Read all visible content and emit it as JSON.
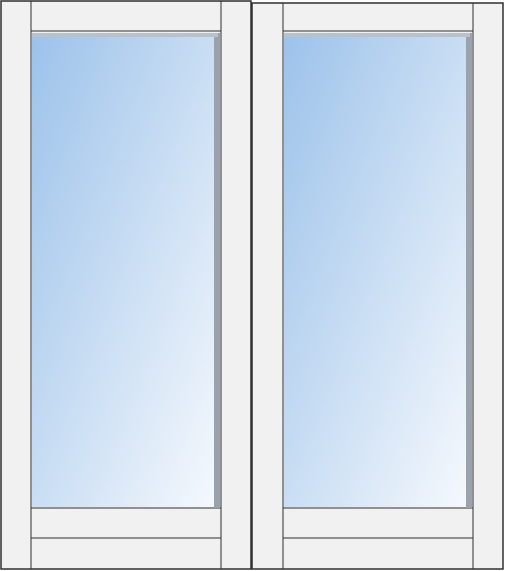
{
  "colors": {
    "frame_fill": "#f1f1f2",
    "frame_stroke": "#2f2f2f",
    "glass_top": "#9cc2ea",
    "glass_bottom": "#f6f9fd",
    "inner_shadow": "#9aa3ad",
    "sash_outline": "#2f2f2f"
  },
  "window": {
    "type": "double casement window (2 sashes)",
    "sash_count": 2
  },
  "icons": {
    "left_sash": "window-sash-icon",
    "right_sash": "window-sash-icon"
  }
}
